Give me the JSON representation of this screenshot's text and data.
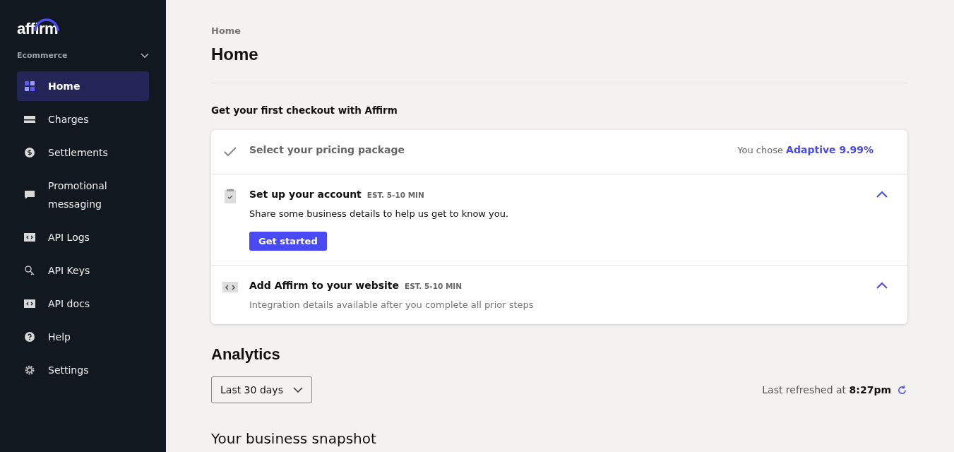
{
  "sidebar": {
    "logo": "affirm",
    "account": "Ecommerce",
    "items": [
      {
        "label": "Home",
        "kind": "grid",
        "selected": true
      },
      {
        "label": "Charges",
        "kind": "card",
        "selected": false
      },
      {
        "label": "Settlements",
        "kind": "dollar",
        "selected": false
      },
      {
        "label": "Promotional messaging",
        "kind": "chat",
        "selected": false
      },
      {
        "label": "API Logs",
        "kind": "code",
        "selected": false
      },
      {
        "label": "API Keys",
        "kind": "key",
        "selected": false
      },
      {
        "label": "API docs",
        "kind": "code",
        "selected": false
      },
      {
        "label": "Help",
        "kind": "help",
        "selected": false
      },
      {
        "label": "Settings",
        "kind": "gear",
        "selected": false
      }
    ]
  },
  "breadcrumb": "Home",
  "title": "Home",
  "checkout": {
    "heading": "Get your first checkout with Affirm",
    "steps": [
      {
        "kind": "done",
        "title": "Select your pricing package",
        "chosen_prefix": "You chose",
        "chosen_value": "Adaptive 9.99%"
      },
      {
        "kind": "open",
        "title": "Set up your account",
        "estimate": "EST. 5-10 MIN",
        "description": "Share some business details to help us get to know you.",
        "button": "Get started",
        "expanded": true,
        "muted": false
      },
      {
        "kind": "open",
        "title": "Add Affirm to your website",
        "estimate": "EST. 5-10 MIN",
        "description": "Integration details available after you complete all prior steps",
        "expanded": true,
        "muted": true
      }
    ]
  },
  "analytics": {
    "title": "Analytics",
    "range": "Last 30 days",
    "refreshed": "Last refreshed at **8:27pm**"
  },
  "snapshot_title": "Your business snapshot"
}
